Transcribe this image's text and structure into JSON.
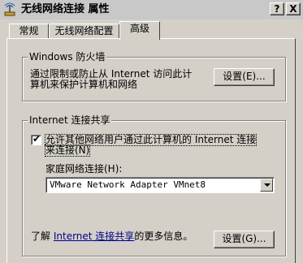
{
  "window": {
    "title": "无线网络连接 属性",
    "help_label": "?",
    "close_label": "X"
  },
  "tabs": [
    {
      "label": "常规"
    },
    {
      "label": "无线网络配置"
    },
    {
      "label": "高级",
      "active": true
    }
  ],
  "firewall": {
    "legend": "Windows 防火墙",
    "description_line1": "通过限制或防止从 Internet 访问此计",
    "description_line2": "算机来保护计算机和网络",
    "settings_button": "设置(E)..."
  },
  "ics": {
    "legend": "Internet 连接共享",
    "allow_checkbox_checked": true,
    "allow_label_line1": "允许其他网络用户通过此计算机的 Internet 连接",
    "allow_label_line2": "来连接(N)",
    "home_network_label": "家庭网络连接(H):",
    "home_network_value": "VMware Network Adapter VMnet8"
  },
  "footer": {
    "learn_prefix": "了解",
    "learn_link": "Internet 连接共享",
    "learn_suffix": "的更多信息。",
    "settings_button": "设置(G)..."
  }
}
